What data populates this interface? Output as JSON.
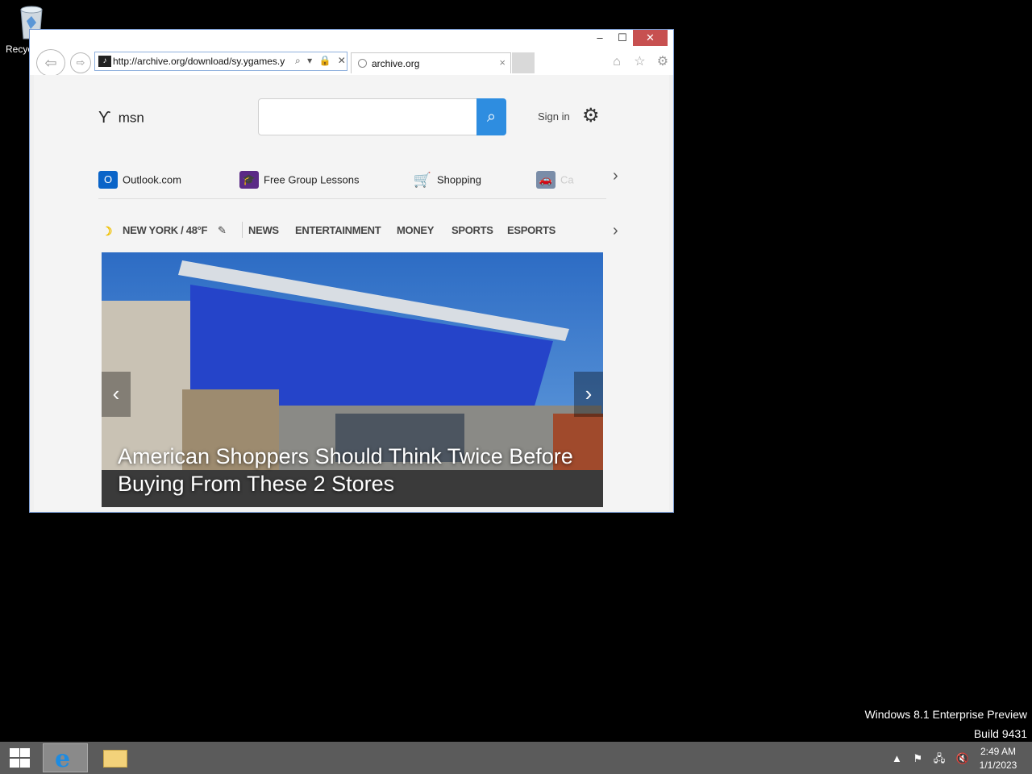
{
  "desktop": {
    "recycle_label": "Recyc",
    "watermark_line1": "Windows 8.1 Enterprise Preview",
    "watermark_line2": "Build 9431"
  },
  "window": {
    "minimize": "–",
    "maximize": "☐",
    "close": "✕"
  },
  "browser": {
    "back": "⇦",
    "forward": "⇨",
    "address": "http://archive.org/download/sy.ygames.y",
    "address_icons": [
      "⌕",
      "▾",
      "🔒",
      "✕"
    ],
    "tab_title": "archive.org",
    "tab_close": "×",
    "home": "⌂",
    "favorites": "☆",
    "tools": "⚙"
  },
  "msn": {
    "logo_text": "msn",
    "search_placeholder": "",
    "search_icon": "⌕",
    "sign_in": "Sign in",
    "settings_icon": "⚙",
    "quicklinks": [
      {
        "label": "Outlook.com",
        "icon": "O"
      },
      {
        "label": "Free Group Lessons",
        "icon": "🎓"
      },
      {
        "label": "Shopping",
        "icon": "🛒"
      },
      {
        "label": "Ca",
        "icon": "🚗"
      }
    ],
    "weather": "NEW YORK / 48°F",
    "nav": [
      "NEWS",
      "ENTERTAINMENT",
      "MONEY",
      "SPORTS",
      "ESPORTS"
    ],
    "hero_title": "American Shoppers Should Think Twice Before Buying From These 2 Stores",
    "chevron": "›",
    "hero_prev": "‹",
    "hero_next": "›"
  },
  "taskbar": {
    "time": "2:49 AM",
    "date": "1/1/2023",
    "tray_icons": [
      "▲",
      "⚑",
      "🖧",
      "🔇"
    ]
  },
  "colors": {
    "accent": "#2e8de0",
    "close_button": "#c75050",
    "taskbar": "#5b5b5b"
  }
}
